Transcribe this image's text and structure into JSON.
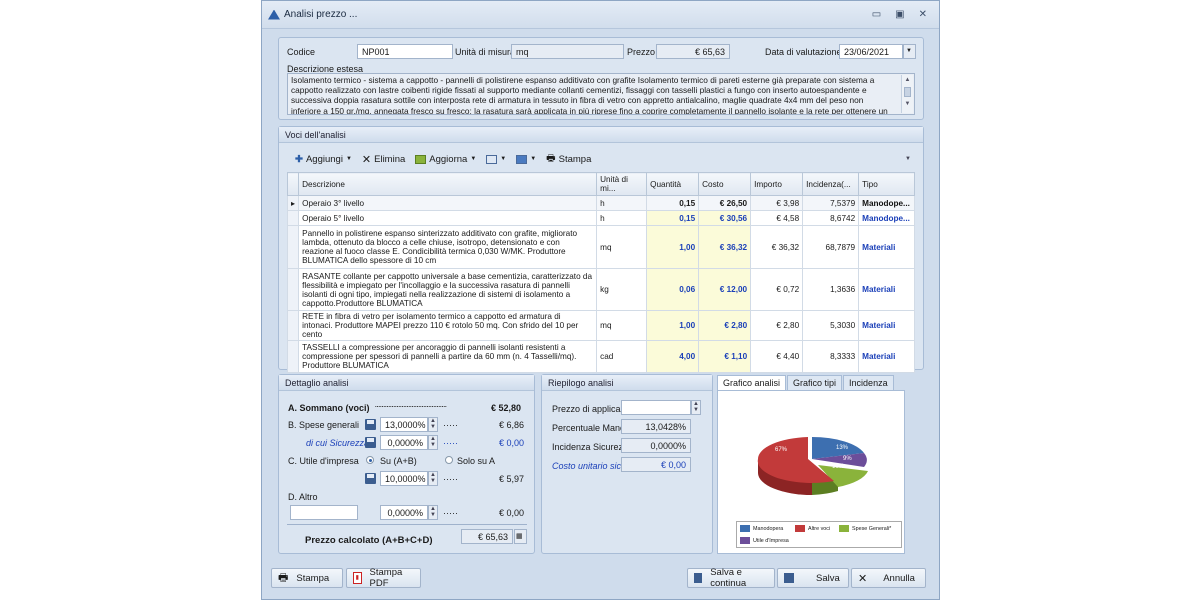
{
  "window": {
    "title": "Analisi prezzo ...",
    "controls": [
      "▭",
      "▣",
      "✕"
    ]
  },
  "header": {
    "codice_label": "Codice",
    "codice_value": "NP001",
    "um_label": "Unità di misura",
    "um_value": "mq",
    "prezzo_label": "Prezzo",
    "prezzo_value": "€ 65,63",
    "data_label": "Data di valutazione",
    "data_value": "23/06/2021",
    "descrizione_label": "Descrizione estesa",
    "descrizione_text": "Isolamento termico - sistema a cappotto - pannelli di polistirene espanso additivato con grafite Isolamento termico di pareti esterne già preparate con sistema a cappotto realizzato con lastre coibenti rigide fissati al supporto mediante collanti cementizi,  fissaggi con tasselli plastici a fungo con inserto autoespandente e successiva doppia rasatura sottile con interposta rete di armatura in tessuto in fibra di vetro con appretto antialcalino, maglie quadrate 4x4 mm del peso non inferiore a 150  gr./mq, annegata fresco su fresco; la rasatura sarà applicata in più riprese fino a coprire completamente il pannello isolante e la rete per ottenere un sottofondo continuo ed"
  },
  "voci": {
    "title": "Voci dell'analisi",
    "toolbar": {
      "aggiungi": "Aggiungi",
      "elimina": "Elimina",
      "aggiorna": "Aggiorna",
      "stampa": "Stampa"
    },
    "columns": [
      "Descrizione",
      "Unità di mi...",
      "Quantità",
      "Costo",
      "Importo",
      "Incidenza(...",
      "Tipo"
    ],
    "rows": [
      {
        "descrizione": "Operaio 3° livello",
        "um": "h",
        "quantita": "0,15",
        "costo": "€ 26,50",
        "importo": "€ 3,98",
        "incidenza": "7,5379",
        "tipo": "Manodope..."
      },
      {
        "descrizione": "Operaio 5° livello",
        "um": "h",
        "quantita": "0,15",
        "costo": "€ 30,56",
        "importo": "€ 4,58",
        "incidenza": "8,6742",
        "tipo": "Manodope..."
      },
      {
        "descrizione": "Pannello in polistirene espanso sinterizzato additivato con grafite, migliorato lambda, ottenuto da blocco a celle chiuse, isotropo, detensionato e con reazione al fuoco classe E. Condicibilità termica  0,030 W/MK. Produttore BLUMATICA dello spessore di 10 cm",
        "um": "mq",
        "quantita": "1,00",
        "costo": "€ 36,32",
        "importo": "€ 36,32",
        "incidenza": "68,7879",
        "tipo": "Materiali"
      },
      {
        "descrizione": "RASANTE collante  per cappotto universale a base cementizia, caratterizzato da flessibilità e impiegato per l'incollaggio e la successiva rasatura di pannelli isolanti di ogni tipo, impiegati nella realizzazione di sistemi di isolamento a cappotto.Produttore BLUMATICA",
        "um": "kg",
        "quantita": "0,06",
        "costo": "€ 12,00",
        "importo": "€ 0,72",
        "incidenza": "1,3636",
        "tipo": "Materiali"
      },
      {
        "descrizione": "RETE in fibra di vetro per isolamento termico a cappotto ed armatura di intonaci. Produttore MAPEI prezzo 110 € rotolo 50 mq. Con sfrido del 10 per cento",
        "um": "mq",
        "quantita": "1,00",
        "costo": "€ 2,80",
        "importo": "€ 2,80",
        "incidenza": "5,3030",
        "tipo": "Materiali"
      },
      {
        "descrizione": "TASSELLI a compressione per ancoraggio di pannelli isolanti resistenti a compressione per spessori di pannelli a partire da 60 mm (n. 4 Tasselli/mq). Produttore BLUMATICA",
        "um": "cad",
        "quantita": "4,00",
        "costo": "€ 1,10",
        "importo": "€ 4,40",
        "incidenza": "8,3333",
        "tipo": "Materiali"
      }
    ]
  },
  "dettaglio": {
    "title": "Dettaglio analisi",
    "a_label": "A. Sommano (voci)",
    "a_dots": "...........................................",
    "a_value": "€ 52,80",
    "b_label": "B. Spese generali",
    "b_pct": "13,0000%",
    "b_value": "€ 6,86",
    "sic_label": "di cui Sicurezza",
    "sic_pct": "0,0000%",
    "sic_value": "€ 0,00",
    "c_label": "C. Utile d'impresa",
    "c_opt1": "Su (A+B)",
    "c_opt2": "Solo su A",
    "c_pct": "10,0000%",
    "c_value": "€ 5,97",
    "d_label": "D. Altro",
    "d_input": "",
    "d_pct": "0,0000%",
    "d_value": "€ 0,00",
    "dots": "·····",
    "tot_label": "Prezzo calcolato (A+B+C+D)",
    "tot_value": "€ 65,63"
  },
  "riepilogo": {
    "title": "Riepilogo analisi",
    "prezzo_label": "Prezzo di applicazi",
    "prezzo_value": "",
    "mano_label": "Percentuale Mano",
    "mano_value": "13,0428%",
    "sic_label": "Incidenza Sicurezz",
    "sic_value": "0,0000%",
    "costo_label": "Costo unitario sic",
    "costo_value": "€ 0,00"
  },
  "grafico": {
    "tabs": [
      "Grafico analisi",
      "Grafico tipi",
      "Incidenza"
    ],
    "active_tab": 0,
    "slices": [
      {
        "label": "Manodopera",
        "pct_label": "13%",
        "color": "#3d6fb0"
      },
      {
        "label": "Altre voci",
        "pct_label": "67%",
        "color": "#c23a3a"
      },
      {
        "label": "Spese Generali*",
        "pct_label": "10%",
        "color": "#8ab33b"
      },
      {
        "label": "Utile d'Impresa",
        "pct_label": "9%",
        "color": "#6c4e9a"
      }
    ]
  },
  "footer": {
    "stampa": "Stampa",
    "stampa_pdf": "Stampa PDF",
    "salva_continua": "Salva e continua",
    "salva": "Salva",
    "annulla": "Annulla"
  }
}
